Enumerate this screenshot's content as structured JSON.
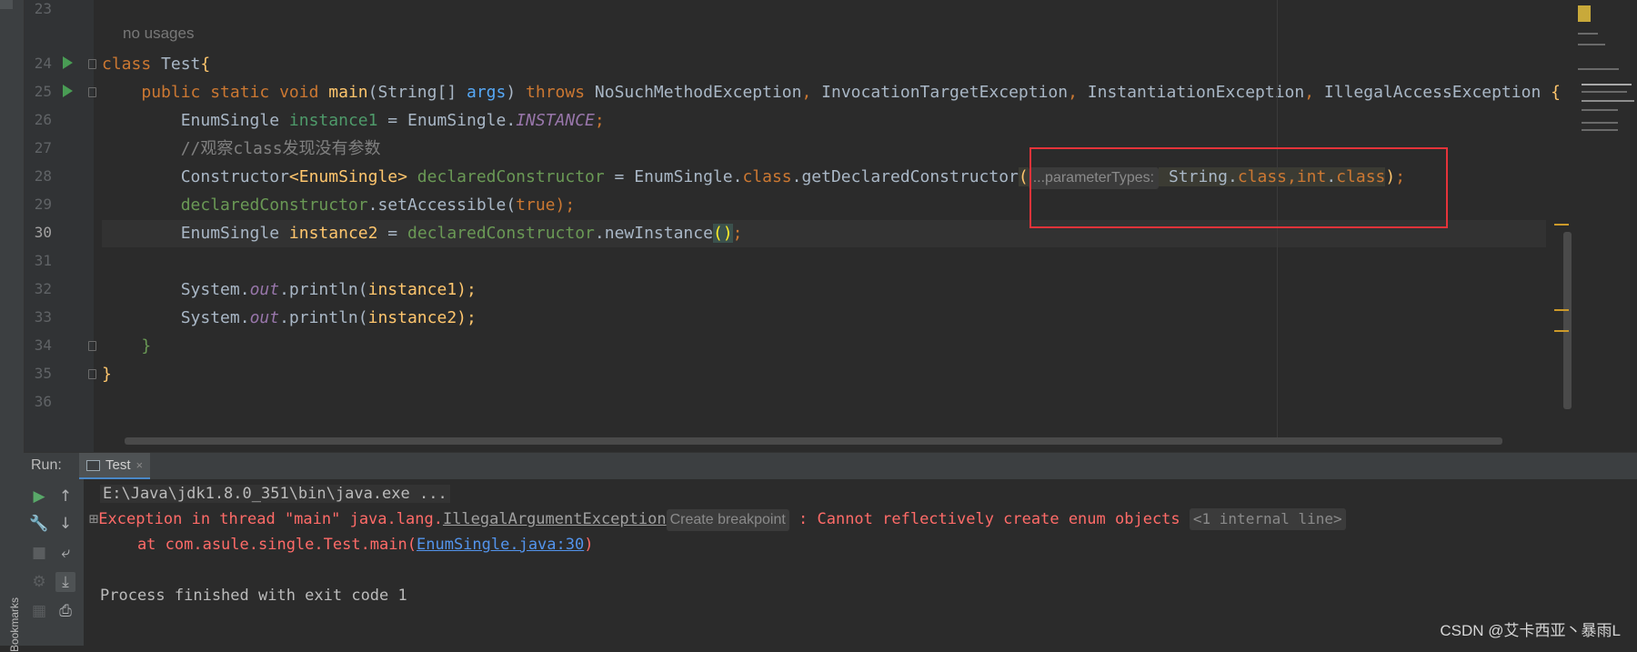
{
  "editor": {
    "line_numbers": [
      "23",
      "24",
      "25",
      "26",
      "27",
      "28",
      "29",
      "30",
      "31",
      "32",
      "33",
      "34",
      "35",
      "36"
    ],
    "no_usages": "no usages",
    "code": {
      "l24_kw": "class",
      "l24_name": " Test",
      "l24_brace": "{",
      "l25_mods": "public static void ",
      "l25_fn": "main",
      "l25_open": "(String[] ",
      "l25_args": "args",
      "l25_close": ") ",
      "l25_throws": "throws ",
      "l25_ex1": "NoSuchMethodException",
      "l25_sep1": ", ",
      "l25_ex2": "InvocationTargetException",
      "l25_sep2": ", ",
      "l25_ex3": "InstantiationException",
      "l25_sep3": ", ",
      "l25_ex4": "IllegalAccessException",
      "l25_brace": " {",
      "l26_type": "EnumSingle ",
      "l26_var": "instance1",
      "l26_eq": " = EnumSingle.",
      "l26_fld": "INSTANCE",
      "l26_semi": ";",
      "l27_comment": "//观察class发现没有参数",
      "l28_type": "Constructor",
      "l28_generic": "<EnumSingle>",
      "l28_var": " declaredConstructor",
      "l28_eq": " = EnumSingle.",
      "l28_class": "class",
      "l28_call": ".getDeclaredConstructor",
      "l28_open": "(",
      "l28_hint": "...parameterTypes:",
      "l28_arg_type": " String.",
      "l28_arg_cls1": "class",
      "l28_comma": ",",
      "l28_int": "int",
      "l28_dot": ".",
      "l28_arg_cls2": "class",
      "l28_close": ")",
      "l28_semi": ";",
      "l29_var": "declaredConstructor",
      "l29_call": ".setAccessible(",
      "l29_true": "true",
      "l29_end": ");",
      "l30_type": "EnumSingle ",
      "l30_var": "instance2",
      "l30_eq": " = ",
      "l30_ref": "declaredConstructor",
      "l30_call": ".newInstance",
      "l30_parens": "()",
      "l30_semi": ";",
      "l32_sys": "System.",
      "l32_out": "out",
      "l32_call": ".println(",
      "l32_arg": "instance1",
      "l32_end": ");",
      "l33_sys": "System.",
      "l33_out": "out",
      "l33_call": ".println(",
      "l33_arg": "instance2",
      "l33_end": ");",
      "l34_brace": "}",
      "l35_brace": "}"
    }
  },
  "run_panel": {
    "label": "Run:",
    "tab_title": "Test",
    "tab_close": "×",
    "console": {
      "cmd": "E:\\Java\\jdk1.8.0_351\\bin\\java.exe ...",
      "exc_prefix": "Exception in thread \"main\" java.lang.",
      "exc_class": "IllegalArgumentException",
      "create_breakpoint": "Create breakpoint",
      "exc_message": " : Cannot reflectively create enum objects ",
      "internal_line": "<1 internal line>",
      "at_prefix": "    at com.asule.single.Test.main(",
      "at_link": "EnumSingle.java:30",
      "at_suffix": ")",
      "exit": "Process finished with exit code 1"
    }
  },
  "side": {
    "bookmarks": "Bookmarks"
  },
  "watermark": "CSDN @艾卡西亚丶暴雨L"
}
